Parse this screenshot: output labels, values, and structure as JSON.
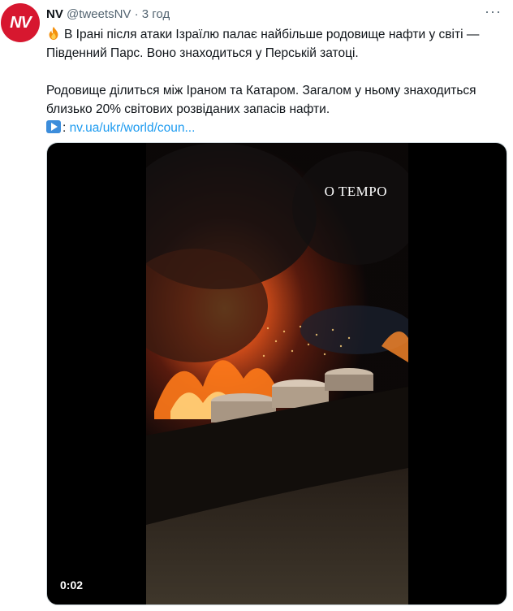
{
  "tweet": {
    "avatar_text": "NV",
    "name": "NV",
    "handle": "@tweetsNV",
    "separator": "·",
    "time": "3 год",
    "more_label": "···",
    "line1": "В Ірані після атаки Ізраїлю палає найбільше родовище нафти у світі — Південний Парс. Воно знаходиться у Перській затоці.",
    "line2": "Родовище ділиться між Іраном та Катаром. Загалом у ньому знаходиться близько 20% світових розвіданих запасів нафти.",
    "link_prefix": ":",
    "link_text": "nv.ua/ukr/world/coun...",
    "icons": [
      "fire-emoji",
      "play-button-emoji",
      "more-icon"
    ]
  },
  "media": {
    "duration": "0:02",
    "watermark": "O TEMPO"
  },
  "colors": {
    "brand": "#d7172f",
    "link": "#1d9bf0",
    "secondary": "#536471"
  }
}
